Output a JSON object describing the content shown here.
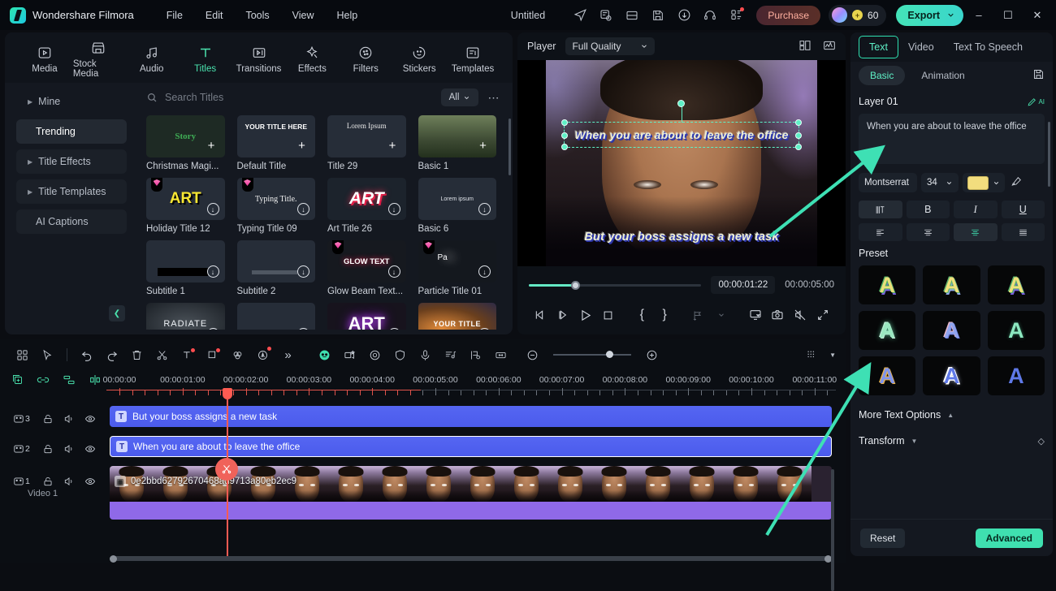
{
  "titlebar": {
    "brand": "Wondershare Filmora",
    "menus": [
      "File",
      "Edit",
      "Tools",
      "View",
      "Help"
    ],
    "document_title": "Untitled",
    "purchase_label": "Purchase",
    "credits": "60",
    "export_label": "Export",
    "icons": [
      "send-icon",
      "project-settings-icon",
      "layout-icon",
      "save-icon",
      "upload-cloud-icon",
      "support-headset-icon",
      "apps-grid-icon"
    ],
    "window_controls": [
      "minimize",
      "maximize",
      "close"
    ]
  },
  "library": {
    "categories": [
      {
        "label": "Media",
        "icon": "media-icon",
        "active": false
      },
      {
        "label": "Stock Media",
        "icon": "stock-media-icon",
        "active": false
      },
      {
        "label": "Audio",
        "icon": "audio-icon",
        "active": false
      },
      {
        "label": "Titles",
        "icon": "titles-icon",
        "active": true
      },
      {
        "label": "Transitions",
        "icon": "transitions-icon",
        "active": false
      },
      {
        "label": "Effects",
        "icon": "effects-icon",
        "active": false
      },
      {
        "label": "Filters",
        "icon": "filters-icon",
        "active": false
      },
      {
        "label": "Stickers",
        "icon": "stickers-icon",
        "active": false
      },
      {
        "label": "Templates",
        "icon": "templates-icon",
        "active": false
      }
    ],
    "sidebar": [
      {
        "label": "Mine",
        "expandable": true,
        "selected": false
      },
      {
        "label": "Trending",
        "expandable": false,
        "selected": true
      },
      {
        "label": "Title Effects",
        "expandable": true,
        "selected": false
      },
      {
        "label": "Title Templates",
        "expandable": true,
        "selected": false
      },
      {
        "label": "AI Captions",
        "expandable": false,
        "selected": false
      }
    ],
    "search_placeholder": "Search Titles",
    "search_value": "",
    "filter_label": "All",
    "items": [
      {
        "label": "Christmas Magi...",
        "preview": "Story",
        "badge": "plus",
        "gem": false
      },
      {
        "label": "Default Title",
        "preview": "YOUR TITLE HERE",
        "badge": "plus",
        "gem": false
      },
      {
        "label": "Title 29",
        "preview": "Lorem Ipsum",
        "badge": "plus",
        "gem": false
      },
      {
        "label": "Basic 1",
        "preview": "",
        "badge": "plus",
        "gem": false
      },
      {
        "label": "Holiday Title 12",
        "preview": "ART",
        "badge": "download",
        "gem": true
      },
      {
        "label": "Typing Title 09",
        "preview": "Typing Title.",
        "badge": "download",
        "gem": true
      },
      {
        "label": "Art Title 26",
        "preview": "ART",
        "badge": "download",
        "gem": false
      },
      {
        "label": "Basic 6",
        "preview": "Lorem ipsum",
        "badge": "download",
        "gem": false
      },
      {
        "label": "Subtitle 1",
        "preview": "",
        "badge": "download",
        "gem": false
      },
      {
        "label": "Subtitle 2",
        "preview": "",
        "badge": "download",
        "gem": false
      },
      {
        "label": "Glow Beam Text...",
        "preview": "GLOW TEXT",
        "badge": "download",
        "gem": true
      },
      {
        "label": "Particle Title 01",
        "preview": "Pa",
        "badge": "download",
        "gem": true
      },
      {
        "label": "",
        "preview": "RADIATE",
        "badge": "download",
        "gem": false
      },
      {
        "label": "",
        "preview": "",
        "badge": "download",
        "gem": false
      },
      {
        "label": "",
        "preview": "ART",
        "badge": "download",
        "gem": false
      },
      {
        "label": "",
        "preview": "YOUR TITLE",
        "badge": "download",
        "gem": false
      }
    ]
  },
  "player": {
    "label": "Player",
    "quality": "Full Quality",
    "current_time": "00:00:01:22",
    "duration": "00:00:05:00",
    "overlay_top": "When you are about to leave the office",
    "overlay_bottom": "But your boss assigns a new task",
    "controls": [
      "prev-frame",
      "next-frame",
      "play",
      "stop",
      "mark-in",
      "mark-out",
      "add-marker",
      "marker-dropdown",
      "screen-cast",
      "snapshot",
      "mute",
      "fullscreen"
    ],
    "header_icons": [
      "split-view-icon",
      "scope-icon"
    ]
  },
  "inspector": {
    "tabs": [
      "Text",
      "Video",
      "Text To Speech"
    ],
    "active_tab": "Text",
    "subtabs": [
      "Basic",
      "Animation"
    ],
    "active_subtab": "Basic",
    "save_icon": "save-preset-icon",
    "layer_label": "Layer 01",
    "layer_ai_icon": "ai-write-icon",
    "text_value": "When you are about to leave the office",
    "font_family": "Montserrat",
    "font_size": "34",
    "font_color": "#F2DD7E",
    "eyedropper_icon": "eyedropper-icon",
    "style_buttons": [
      "text-spacing",
      "B",
      "I",
      "U"
    ],
    "align_buttons": [
      "align-left",
      "align-center-v",
      "align-center",
      "align-justify"
    ],
    "active_align_index": 2,
    "preset_heading": "Preset",
    "presets": [
      {
        "letter": "A",
        "fill": "#eadf7a",
        "stroke": "#4cae62",
        "shadow": "#7b62e0"
      },
      {
        "letter": "A",
        "fill": "#f0e07c",
        "stroke": "#5fb36d",
        "shadow": "#8fa8e8"
      },
      {
        "letter": "A",
        "fill": "#efe07a",
        "stroke": "#55b06a",
        "shadow": "#7a5fe0"
      },
      {
        "letter": "A",
        "fill": "#9ae8c0",
        "stroke": "#dff5e8",
        "shadow": "#6fe3b0"
      },
      {
        "letter": "A",
        "fill": "#8fa4ee",
        "stroke": "#e9b6c8",
        "shadow": "#6f7fe0"
      },
      {
        "letter": "A",
        "fill": "#8ce8c0",
        "stroke": "#8ce8c0",
        "shadow": "#2e6b52"
      },
      {
        "letter": "A",
        "fill": "#7f94ec",
        "stroke": "#e8b24a",
        "shadow": "#5f73d6"
      },
      {
        "letter": "A",
        "fill": "#5f79e8",
        "stroke": "#ffffff",
        "shadow": "#c9d2f2"
      },
      {
        "letter": "A",
        "fill": "#5f79e8",
        "stroke": "#5f79e8",
        "shadow": "#2b3a8c"
      }
    ],
    "more_text_options": "More Text Options",
    "transform": "Transform",
    "reset_label": "Reset",
    "advanced_label": "Advanced"
  },
  "timeline": {
    "toolbar_icons": [
      "layouts-icon",
      "cursor-select-icon",
      "undo-icon",
      "redo-icon",
      "delete-icon",
      "split-scissors-icon",
      "text-tool-icon",
      "crop-icon",
      "color-match-icon",
      "ai-tools-icon",
      "more-chevrons-icon",
      "ai-portrait-icon",
      "green-screen-icon",
      "motion-tracking-icon",
      "mask-icon",
      "record-voiceover-icon",
      "audio-mixer-icon",
      "marker-icon",
      "fit-timeline-icon",
      "zoom-out-icon",
      "zoom-in-icon",
      "render-preview-icon"
    ],
    "zoom_value": 72,
    "track_tool_icons": [
      "add-track-icon",
      "link-icon",
      "group-icon",
      "split-all-icon"
    ],
    "ruler_labels": [
      "00:00:00",
      "00:00:01:00",
      "00:00:02:00",
      "00:00:03:00",
      "00:00:04:00",
      "00:00:05:00",
      "00:00:06:00",
      "00:00:07:00",
      "00:00:08:00",
      "00:00:09:00",
      "00:00:10:00",
      "00:00:11:00"
    ],
    "playhead_time": "00:00:02:00",
    "tracks": [
      {
        "number": "3",
        "type": "text",
        "clip_label": "But your boss assigns a new task",
        "selected": false
      },
      {
        "number": "2",
        "type": "text",
        "clip_label": "When you are about to leave the office",
        "selected": true
      },
      {
        "number": "1",
        "type": "video",
        "clip_label": "0e2bbd62792670468ad9713a80eb2ec9",
        "track_name": "Video 1",
        "selected": false
      }
    ],
    "track_controls": [
      "lock-icon",
      "mute-speaker-icon",
      "eye-visible-icon"
    ],
    "split_button_icon": "split-scissors-icon"
  },
  "annotations": {
    "arrow_color": "#3ee0b4",
    "arrows": 2
  }
}
